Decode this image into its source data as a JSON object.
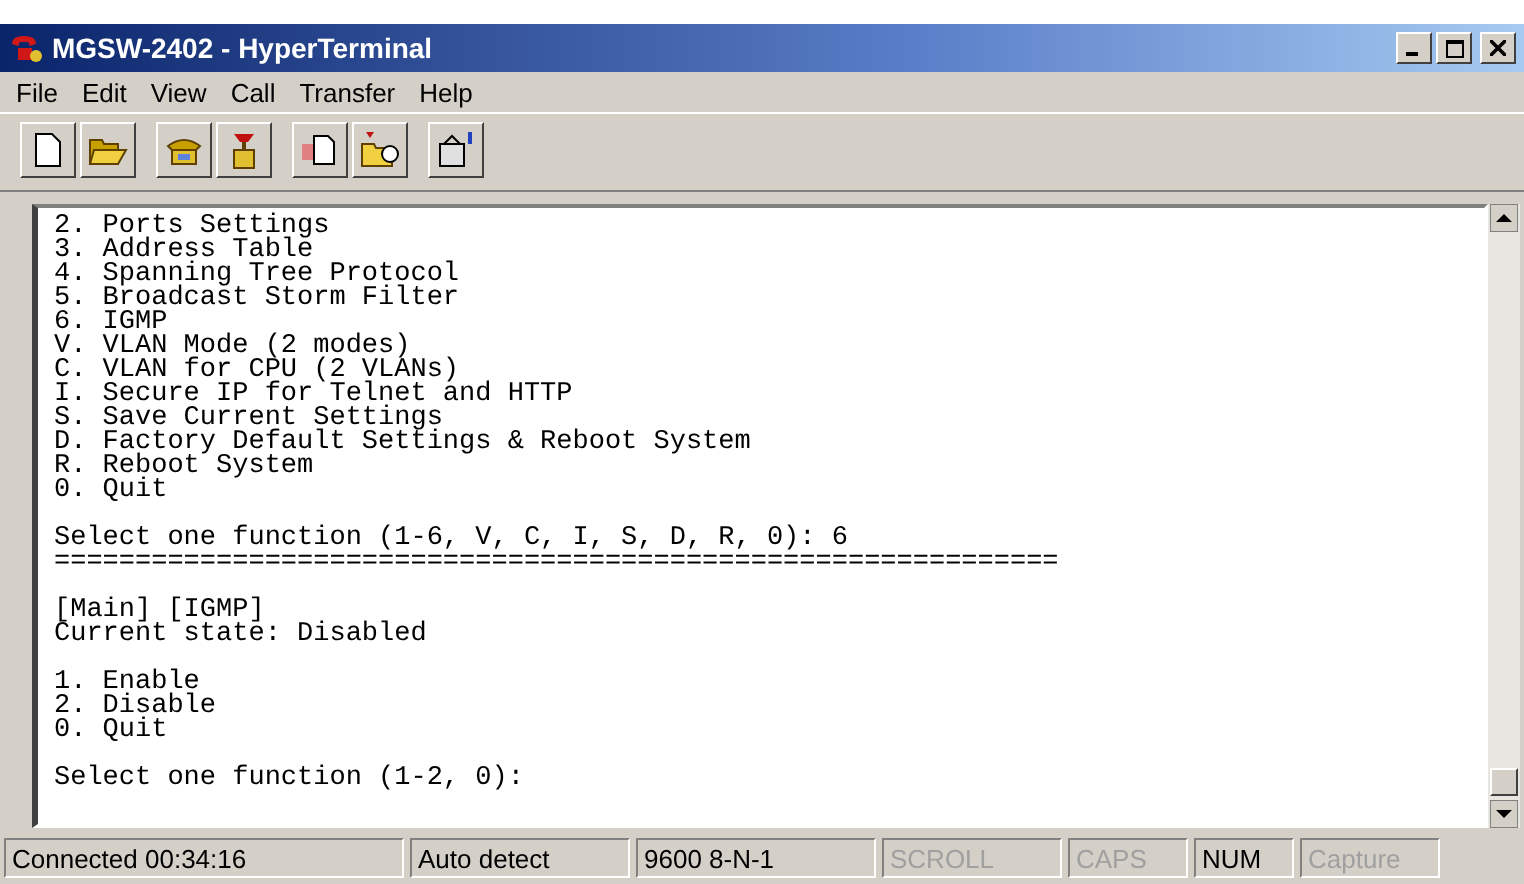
{
  "window": {
    "title": "MGSW-2402 - HyperTerminal"
  },
  "menu": [
    "File",
    "Edit",
    "View",
    "Call",
    "Transfer",
    "Help"
  ],
  "terminal": {
    "blocks": [
      {
        "lines": [
          "2. Ports Settings",
          "3. Address Table",
          "4. Spanning Tree Protocol",
          "5. Broadcast Storm Filter",
          "6. IGMP",
          "V. VLAN Mode (2 modes)",
          "C. VLAN for CPU (2 VLANs)",
          "I. Secure IP for Telnet and HTTP",
          "S. Save Current Settings",
          "D. Factory Default Settings & Reboot System",
          "R. Reboot System",
          "0. Quit"
        ]
      },
      {
        "lines": [
          "Select one function (1-6, V, C, I, S, D, R, 0): 6",
          "=============================================================="
        ]
      },
      {
        "lines": [
          "[Main] [IGMP]",
          "Current state: Disabled"
        ]
      },
      {
        "lines": [
          "1. Enable",
          "2. Disable",
          "0. Quit"
        ]
      },
      {
        "lines": [
          "Select one function (1-2, 0):"
        ]
      }
    ]
  },
  "status_bar": [
    {
      "text": "Connected 00:34:16",
      "active": true
    },
    {
      "text": "Auto detect",
      "active": true
    },
    {
      "text": "9600 8-N-1",
      "active": true
    },
    {
      "text": "SCROLL",
      "active": false
    },
    {
      "text": "CAPS",
      "active": false
    },
    {
      "text": "NUM",
      "active": true
    },
    {
      "text": "Capture",
      "active": false
    }
  ]
}
